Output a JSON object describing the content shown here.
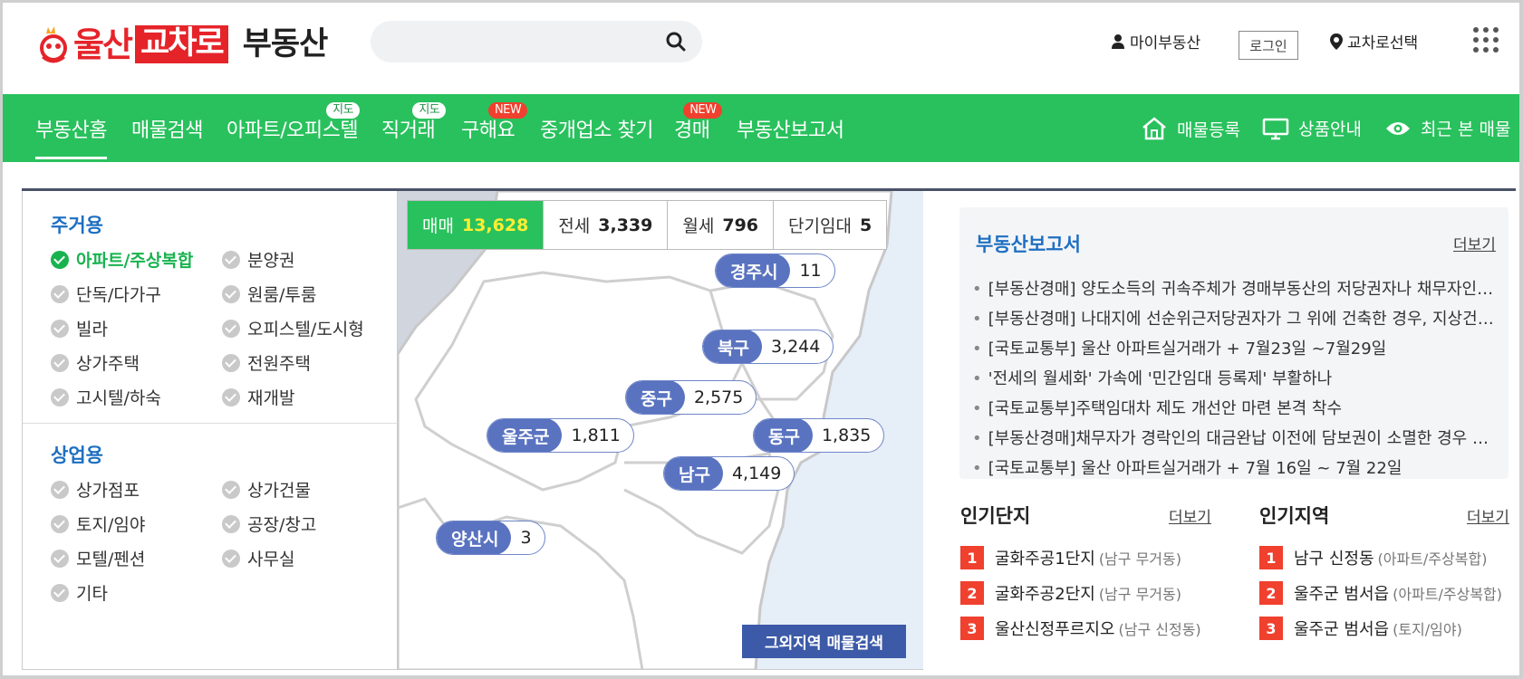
{
  "header": {
    "logo_ulsan": "울산",
    "logo_box": "교차로",
    "logo_suffix": "부동산",
    "search_placeholder": "",
    "my_realestate": "마이부동산",
    "login": "로그인",
    "region_select": "교차로선택"
  },
  "nav": {
    "items": [
      {
        "label": "부동산홈",
        "badge": ""
      },
      {
        "label": "매물검색",
        "badge": ""
      },
      {
        "label": "아파트/오피스텔",
        "badge": "지도"
      },
      {
        "label": "직거래",
        "badge": "지도"
      },
      {
        "label": "구해요",
        "badge": "NEW"
      },
      {
        "label": "중개업소 찾기",
        "badge": ""
      },
      {
        "label": "경매",
        "badge": "NEW"
      },
      {
        "label": "부동산보고서",
        "badge": ""
      }
    ],
    "right": {
      "register": "매물등록",
      "products": "상품안내",
      "recent": "최근 본 매물"
    }
  },
  "categories": {
    "residential_title": "주거용",
    "residential": [
      "아파트/주상복합",
      "분양권",
      "단독/다가구",
      "원룸/투룸",
      "빌라",
      "오피스텔/도시형",
      "상가주택",
      "전원주택",
      "고시텔/하숙",
      "재개발"
    ],
    "commercial_title": "상업용",
    "commercial": [
      "상가점포",
      "상가건물",
      "토지/임야",
      "공장/창고",
      "모텔/펜션",
      "사무실",
      "기타"
    ]
  },
  "map": {
    "tabs": [
      {
        "label": "매매",
        "count": "13,628"
      },
      {
        "label": "전세",
        "count": "3,339"
      },
      {
        "label": "월세",
        "count": "796"
      },
      {
        "label": "단기임대",
        "count": "5"
      }
    ],
    "regions": {
      "gyeongju": {
        "name": "경주시",
        "count": "11"
      },
      "bukgu": {
        "name": "북구",
        "count": "3,244"
      },
      "junggu": {
        "name": "중구",
        "count": "2,575"
      },
      "uljugun": {
        "name": "울주군",
        "count": "1,811"
      },
      "donggu": {
        "name": "동구",
        "count": "1,835"
      },
      "namgu": {
        "name": "남구",
        "count": "4,149"
      },
      "yangsan": {
        "name": "양산시",
        "count": "3"
      }
    },
    "other_region_button": "그외지역 매물검색"
  },
  "report": {
    "title": "부동산보고서",
    "more": "더보기",
    "items": [
      "[부동산경매] 양도소득의 귀속주체가 경매부동산의 저당권자나 채무자인지요?",
      "[부동산경매] 나대지에 선순위근저당권자가 그 위에 건축한 경우, 지상건물의 법정지상권",
      "[국토교통부] 울산 아파트실거래가 + 7월23일 ~7월29일",
      "'전세의 월세화' 가속에 '민간임대 등록제' 부활하나",
      "[국토교통부]주택임대차 제도 개선안 마련 본격 착수",
      "[부동산경매]채무자가 경락인의 대금완납 이전에 담보권이 소멸한 경우 경매",
      "[국토교통부] 울산 아파트실거래가 + 7월 16일 ~ 7월 22일"
    ]
  },
  "popular_complex": {
    "title": "인기단지",
    "more": "더보기",
    "items": [
      {
        "rank": "1",
        "name": "굴화주공1단지",
        "sub": "(남구 무거동)"
      },
      {
        "rank": "2",
        "name": "굴화주공2단지",
        "sub": "(남구 무거동)"
      },
      {
        "rank": "3",
        "name": "울산신정푸르지오",
        "sub": "(남구 신정동)"
      }
    ]
  },
  "popular_region": {
    "title": "인기지역",
    "more": "더보기",
    "items": [
      {
        "rank": "1",
        "name": "남구 신정동",
        "sub": "(아파트/주상복합)"
      },
      {
        "rank": "2",
        "name": "울주군 범서읍",
        "sub": "(아파트/주상복합)"
      },
      {
        "rank": "3",
        "name": "울주군 범서읍",
        "sub": "(토지/임야)"
      }
    ]
  },
  "colors": {
    "brand_red": "#e5242a",
    "nav_green": "#29c15d",
    "accent_blue": "#1e6fc2",
    "pin_blue": "#5a73c0",
    "rank_red": "#f0402e"
  }
}
